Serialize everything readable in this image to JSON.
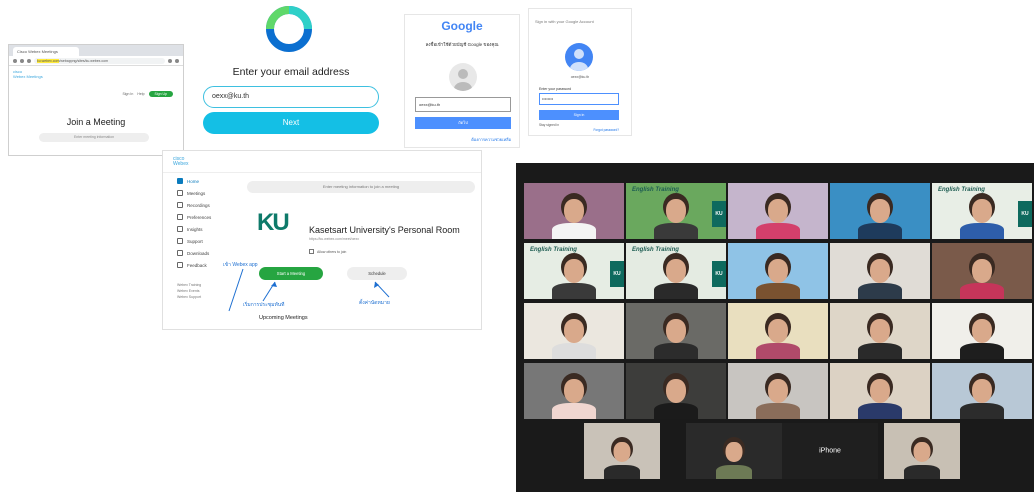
{
  "browser": {
    "tab_title": "Cisco Webex Meetings",
    "url_prefix": "",
    "url_highlight": "ku.webex.com",
    "url_rest": "/webappng/sites/ku.webex.com",
    "brand_line1": "cisco",
    "brand_line2": "Webex Meetings",
    "signin_label": "Sign In",
    "help_label": "Help",
    "signup_label": "Sign Up",
    "join_title": "Join a Meeting",
    "join_placeholder": "Enter meeting information"
  },
  "email_screen": {
    "title": "Enter your email address",
    "email_value": "oexx@ku.th",
    "next_label": "Next"
  },
  "google_signin": {
    "logo": "Google",
    "subtitle": "ลงชื่อเข้าใช้ด้วยบัญชี Google ของคุณ",
    "email_value": "oexx@ku.th",
    "button_label": "ถัดไป",
    "help_link": "ต้องการความช่วยเหลือ"
  },
  "google_password": {
    "header": "Sign in with your Google Account",
    "email": "oexx@ku.th",
    "label": "Enter your password",
    "password_value": "••••••••",
    "button_label": "Sign in",
    "stay_label": "Stay signed in",
    "help_link": "Forgot password?"
  },
  "webex_home": {
    "brand_line1": "cisco",
    "brand_line2": "Webex",
    "nav": [
      {
        "label": "Home",
        "active": true
      },
      {
        "label": "Meetings",
        "active": false
      },
      {
        "label": "Recordings",
        "active": false
      },
      {
        "label": "Preferences",
        "active": false
      },
      {
        "label": "Insights",
        "active": false
      },
      {
        "label": "Support",
        "active": false
      },
      {
        "label": "Downloads",
        "active": false
      },
      {
        "label": "Feedback",
        "active": false
      }
    ],
    "side_footer": [
      "Webex Training",
      "Webex Events",
      "Webex Support"
    ],
    "search_placeholder": "Enter meeting information to join a meeting",
    "ku_logo": "KU",
    "room_title": "Kasetsart University's Personal Room",
    "room_url": "https://ku.webex.com/meet/oexx",
    "checkbox_label": "Allow others to join",
    "start_label": "Start a Meeting",
    "schedule_label": "Schedule",
    "annotation_top": "เข้า Webex app",
    "annotation_start": "เริ่มการประชุมทันที",
    "annotation_schedule": "ตั้งค่านัดหมาย",
    "upcoming_label": "Upcoming Meetings"
  },
  "meeting": {
    "caption": "English Training",
    "ku_badge": "KU",
    "iphone_label": "iPhone"
  }
}
